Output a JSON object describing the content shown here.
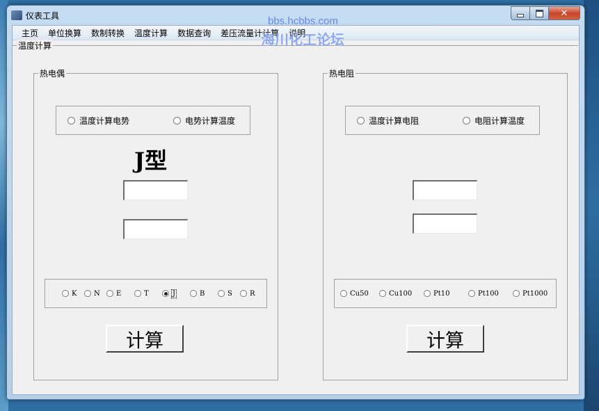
{
  "window": {
    "title": "仪表工具",
    "close_glyph": "✕"
  },
  "watermark": {
    "url": "bbs.hcbbs.com",
    "text": "海川化工论坛"
  },
  "menu": [
    "主页",
    "单位换算",
    "数制转换",
    "温度计算",
    "数据查询",
    "差压流量计计算",
    "说明"
  ],
  "page": {
    "section_title": "温度计算"
  },
  "thermocouple": {
    "title": "热电偶",
    "modes": [
      {
        "label": "温度计算电势",
        "selected": false
      },
      {
        "label": "电势计算温度",
        "selected": false
      }
    ],
    "type_label": "J型",
    "input1": "",
    "input2": "",
    "types": [
      {
        "label": "K",
        "selected": false
      },
      {
        "label": "N",
        "selected": false
      },
      {
        "label": "E",
        "selected": false
      },
      {
        "label": "T",
        "selected": false
      },
      {
        "label": "J",
        "selected": true
      },
      {
        "label": "B",
        "selected": false
      },
      {
        "label": "S",
        "selected": false
      },
      {
        "label": "R",
        "selected": false
      }
    ],
    "calc_label": "计算"
  },
  "rtd": {
    "title": "热电阻",
    "modes": [
      {
        "label": "温度计算电阻",
        "selected": false
      },
      {
        "label": "电阻计算温度",
        "selected": false
      }
    ],
    "input1": "",
    "input2": "",
    "types": [
      {
        "label": "Cu50",
        "selected": false
      },
      {
        "label": "Cu100",
        "selected": false
      },
      {
        "label": "Pt10",
        "selected": false
      },
      {
        "label": "Pt100",
        "selected": false
      },
      {
        "label": "Pt1000",
        "selected": false
      }
    ],
    "calc_label": "计算"
  }
}
